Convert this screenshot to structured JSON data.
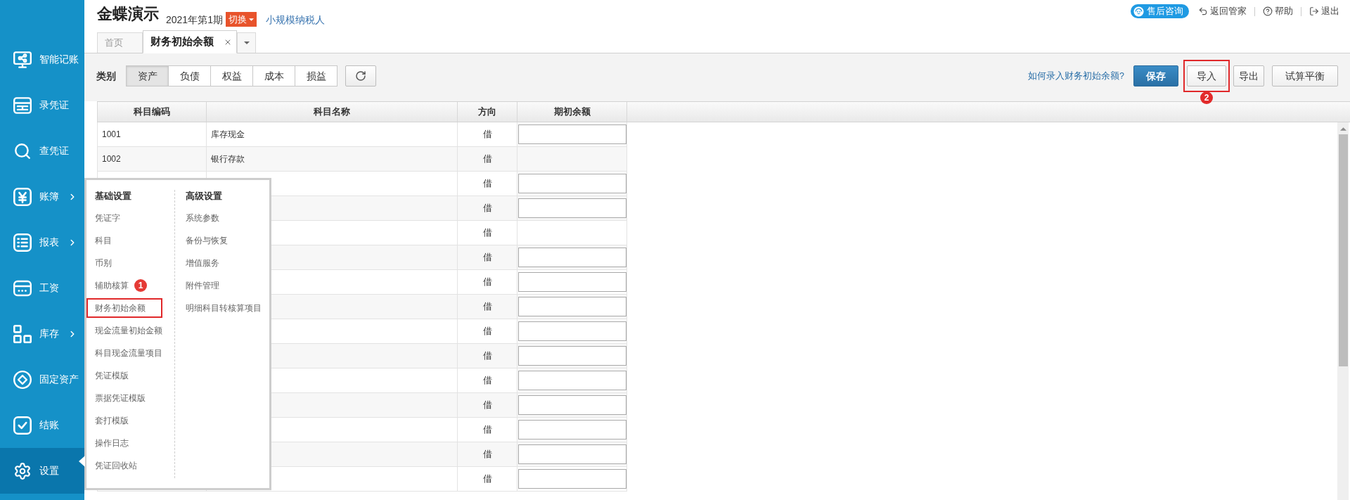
{
  "sidebar": {
    "items": [
      {
        "label": "智能记账",
        "submenu": false,
        "selected": false
      },
      {
        "label": "录凭证",
        "submenu": false,
        "selected": false
      },
      {
        "label": "查凭证",
        "submenu": false,
        "selected": false
      },
      {
        "label": "账簿",
        "submenu": true,
        "selected": false
      },
      {
        "label": "报表",
        "submenu": true,
        "selected": false
      },
      {
        "label": "工资",
        "submenu": false,
        "selected": false
      },
      {
        "label": "库存",
        "submenu": true,
        "selected": false
      },
      {
        "label": "固定资产",
        "submenu": false,
        "selected": false
      },
      {
        "label": "结账",
        "submenu": false,
        "selected": false
      },
      {
        "label": "设置",
        "submenu": false,
        "selected": true
      }
    ]
  },
  "header": {
    "title": "金蝶演示",
    "period": "2021年第1期",
    "switch_button": "切换",
    "taxpayer_type": "小规模纳税人"
  },
  "top_links": [
    {
      "kind": "consult",
      "label": "售后咨询"
    },
    {
      "kind": "back",
      "label": "返回管家"
    },
    {
      "kind": "help",
      "label": "帮助"
    },
    {
      "kind": "logout",
      "label": "退出"
    }
  ],
  "tabs": [
    {
      "label": "首页",
      "selected": false,
      "closable": false
    },
    {
      "label": "财务初始余额",
      "selected": true,
      "closable": true
    }
  ],
  "toolbar": {
    "category_label": "类别",
    "categories": [
      {
        "label": "资产",
        "selected": true
      },
      {
        "label": "负债",
        "selected": false
      },
      {
        "label": "权益",
        "selected": false
      },
      {
        "label": "成本",
        "selected": false
      },
      {
        "label": "损益",
        "selected": false
      }
    ],
    "help_link": "如何录入财务初始余额?",
    "buttons": [
      {
        "label": "保存",
        "kind": "primary",
        "highlighted": false
      },
      {
        "label": "导入",
        "kind": "default",
        "highlighted": true,
        "step_badge": "2"
      },
      {
        "label": "导出",
        "kind": "default",
        "highlighted": false
      },
      {
        "label": "试算平衡",
        "kind": "default",
        "highlighted": false
      }
    ]
  },
  "table": {
    "columns": [
      "科目编码",
      "科目名称",
      "方向",
      "期初余额"
    ],
    "rows": [
      {
        "code": "1001",
        "name": "库存现金",
        "direction": "借",
        "editable": true
      },
      {
        "code": "1002",
        "name": "银行存款",
        "direction": "借",
        "editable": false
      },
      {
        "direction": "借",
        "editable": true
      },
      {
        "direction": "借",
        "editable": true
      },
      {
        "direction": "借",
        "editable": false
      },
      {
        "direction": "借",
        "editable": true
      },
      {
        "direction": "借",
        "editable": true
      },
      {
        "direction": "借",
        "editable": true
      },
      {
        "direction": "借",
        "editable": true
      },
      {
        "direction": "借",
        "editable": true
      },
      {
        "direction": "借",
        "editable": true
      },
      {
        "direction": "借",
        "editable": true
      },
      {
        "direction": "借",
        "editable": true
      },
      {
        "direction": "借",
        "editable": true
      },
      {
        "direction": "借",
        "editable": true
      }
    ]
  },
  "settings_menu": {
    "groups": [
      {
        "heading": "基础设置",
        "items": [
          {
            "label": "凭证字",
            "highlighted": false
          },
          {
            "label": "科目",
            "highlighted": false
          },
          {
            "label": "币别",
            "highlighted": false
          },
          {
            "label": "辅助核算",
            "highlighted": false,
            "step_badge": "1"
          },
          {
            "label": "财务初始余额",
            "highlighted": true
          },
          {
            "label": "现金流量初始金额",
            "highlighted": false
          },
          {
            "label": "科目现金流量项目",
            "highlighted": false
          },
          {
            "label": "凭证模版",
            "highlighted": false
          },
          {
            "label": "票据凭证模版",
            "highlighted": false
          },
          {
            "label": "套打模版",
            "highlighted": false
          },
          {
            "label": "操作日志",
            "highlighted": false
          },
          {
            "label": "凭证回收站",
            "highlighted": false
          }
        ]
      },
      {
        "heading": "高级设置",
        "items": [
          {
            "label": "系统参数",
            "highlighted": false
          },
          {
            "label": "备份与恢复",
            "highlighted": false
          },
          {
            "label": "增值服务",
            "highlighted": false
          },
          {
            "label": "附件管理",
            "highlighted": false
          },
          {
            "label": "明细科目转核算项目",
            "highlighted": false
          }
        ]
      }
    ]
  }
}
